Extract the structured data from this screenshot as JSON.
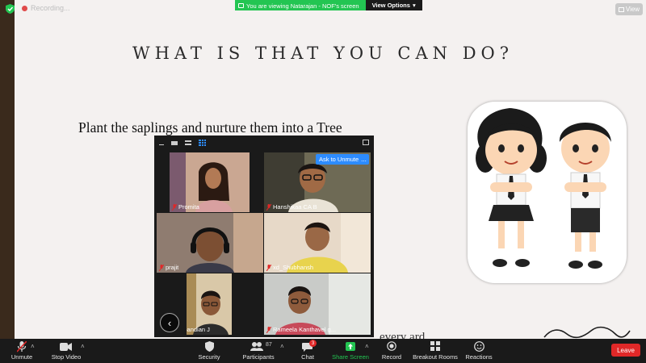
{
  "app": {
    "recording_text": "Recording...",
    "banner_text": "You are viewing Natarajan - NOF's screen",
    "view_options_label": "View Options",
    "view_label": "View"
  },
  "slide": {
    "title": "WHAT IS THAT YOU CAN DO?",
    "text": "Plant the saplings and nurture them into a Tree",
    "bottom_word": "every ard"
  },
  "gallery": {
    "ask_to_unmute_label": "Ask to Unmute",
    "more_label": "...",
    "participants": [
      {
        "name": "Promita"
      },
      {
        "name": "Hanshikaa CA B"
      },
      {
        "name": "prajit"
      },
      {
        "name": "xd_Shubhansh"
      },
      {
        "name": "Sundarapandian J"
      },
      {
        "name": "Rameela Kanthavel g..."
      }
    ]
  },
  "toolbar": {
    "unmute_label": "Unmute",
    "stop_video_label": "Stop Video",
    "security_label": "Security",
    "participants_label": "Participants",
    "participants_count": "87",
    "chat_label": "Chat",
    "chat_badge": "3",
    "share_screen_label": "Share Screen",
    "record_label": "Record",
    "breakout_label": "Breakout Rooms",
    "reactions_label": "Reactions",
    "leave_label": "Leave"
  },
  "colors": {
    "zoom_blue": "#2d8cff",
    "zoom_green": "#23c552",
    "leave_red": "#e02828",
    "toolbar_bg": "#1a1a1a",
    "slide_bg": "#f4f1f0"
  }
}
